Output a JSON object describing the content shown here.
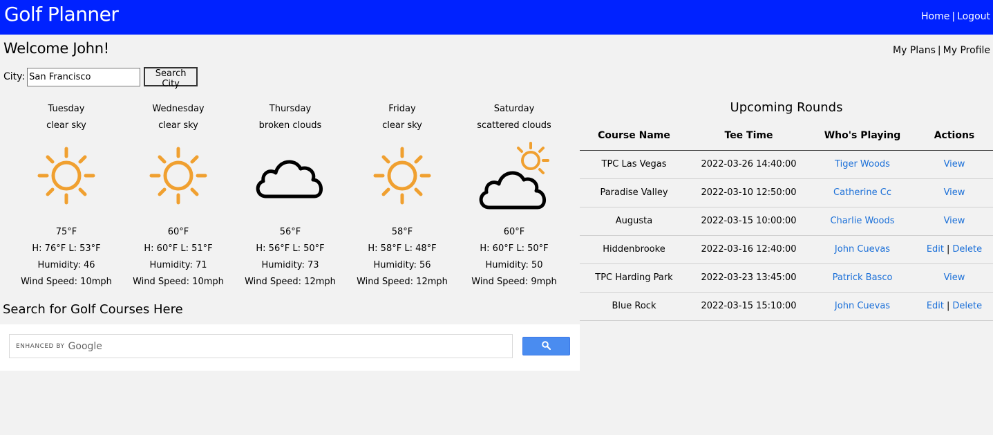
{
  "header": {
    "app_title": "Golf Planner",
    "nav": {
      "home": "Home",
      "separator": "|",
      "logout": "Logout"
    }
  },
  "user": {
    "welcome": "Welcome John!",
    "nav": {
      "my_plans": "My Plans",
      "separator": "|",
      "my_profile": "My Profile"
    }
  },
  "city_search": {
    "label": "City:",
    "value": "San Francisco",
    "button": "Search City"
  },
  "forecast": [
    {
      "day": "Tuesday",
      "desc": "clear sky",
      "icon": "sun-icon",
      "temp": "75°F",
      "hl": "H: 76°F L: 53°F",
      "humidity": "Humidity: 46",
      "wind": "Wind Speed: 10mph"
    },
    {
      "day": "Wednesday",
      "desc": "clear sky",
      "icon": "sun-icon",
      "temp": "60°F",
      "hl": "H: 60°F L: 51°F",
      "humidity": "Humidity: 71",
      "wind": "Wind Speed: 10mph"
    },
    {
      "day": "Thursday",
      "desc": "broken clouds",
      "icon": "cloud-icon",
      "temp": "56°F",
      "hl": "H: 56°F L: 50°F",
      "humidity": "Humidity: 73",
      "wind": "Wind Speed: 12mph"
    },
    {
      "day": "Friday",
      "desc": "clear sky",
      "icon": "sun-icon",
      "temp": "58°F",
      "hl": "H: 58°F L: 48°F",
      "humidity": "Humidity: 56",
      "wind": "Wind Speed: 12mph"
    },
    {
      "day": "Saturday",
      "desc": "scattered clouds",
      "icon": "sun-behind-cloud-icon",
      "temp": "60°F",
      "hl": "H: 60°F L: 50°F",
      "humidity": "Humidity: 50",
      "wind": "Wind Speed: 9mph"
    }
  ],
  "golf_search": {
    "heading": "Search for Golf Courses Here",
    "enhanced_by": "ENHANCED BY",
    "google": "Google",
    "button_icon": "search-icon"
  },
  "rounds": {
    "title": "Upcoming Rounds",
    "columns": [
      "Course Name",
      "Tee Time",
      "Who's Playing",
      "Actions"
    ],
    "rows": [
      {
        "course": "TPC Las Vegas",
        "tee_time": "2022-03-26 14:40:00",
        "player": "Tiger Woods",
        "actions": [
          "View"
        ]
      },
      {
        "course": "Paradise Valley",
        "tee_time": "2022-03-10 12:50:00",
        "player": "Catherine Cc",
        "actions": [
          "View"
        ]
      },
      {
        "course": "Augusta",
        "tee_time": "2022-03-15 10:00:00",
        "player": "Charlie Woods",
        "actions": [
          "View"
        ]
      },
      {
        "course": "Hiddenbrooke",
        "tee_time": "2022-03-16 12:40:00",
        "player": "John Cuevas",
        "actions": [
          "Edit",
          "Delete"
        ]
      },
      {
        "course": "TPC Harding Park",
        "tee_time": "2022-03-23 13:45:00",
        "player": "Patrick Basco",
        "actions": [
          "View"
        ]
      },
      {
        "course": "Blue Rock",
        "tee_time": "2022-03-15 15:10:00",
        "player": "John Cuevas",
        "actions": [
          "Edit",
          "Delete"
        ]
      }
    ],
    "action_separator": "|"
  },
  "colors": {
    "header_bg": "#0022ff",
    "link": "#1a6fd8",
    "sun": "#f0a030",
    "search_button": "#4a8cf0"
  }
}
